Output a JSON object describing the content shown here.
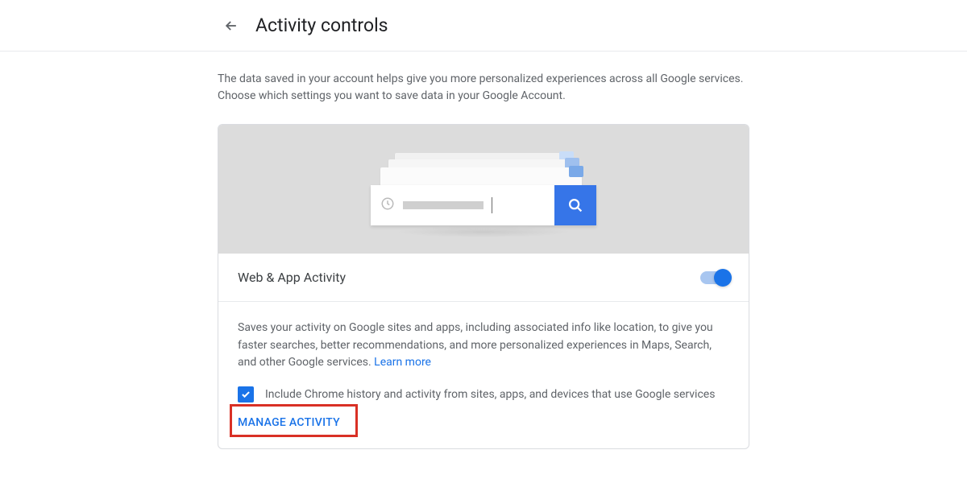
{
  "header": {
    "title": "Activity controls"
  },
  "intro": "The data saved in your account helps give you more personalized experiences across all Google services. Choose which settings you want to save data in your Google Account.",
  "section": {
    "title": "Web & App Activity",
    "toggle_on": true,
    "description_pre": "Saves your activity on Google sites and apps, including associated info like location, to give you faster searches, better recommendations, and more personalized experiences in Maps, Search, and other Google services. ",
    "learn_more": "Learn more",
    "checkbox_label": "Include Chrome history and activity from sites, apps, and devices that use Google services",
    "manage_label": "MANAGE ACTIVITY"
  }
}
